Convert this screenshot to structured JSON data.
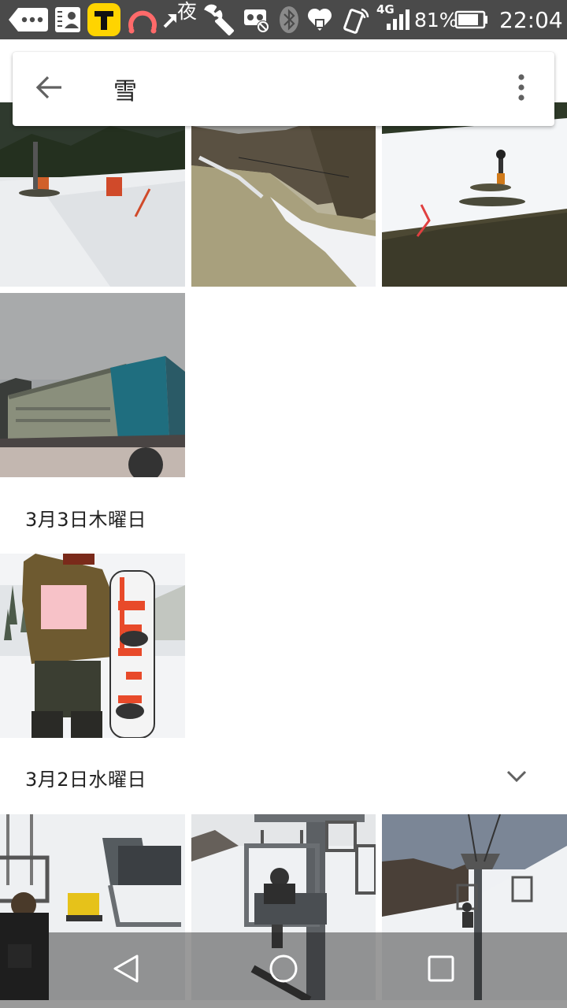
{
  "status_bar": {
    "night_label": "夜",
    "network_label": "4G",
    "battery_percent": "81%",
    "time": "22:04"
  },
  "search": {
    "query": "雪"
  },
  "sections": [
    {
      "date": "3月3日木曜日"
    },
    {
      "date": "3月2日水曜日"
    }
  ],
  "icons": {
    "back": "arrow-back-icon",
    "more": "more-vert-icon",
    "collapse": "chevron-down-icon",
    "nav_back": "nav-back-icon",
    "nav_home": "nav-home-icon",
    "nav_recents": "nav-recents-icon"
  },
  "colors": {
    "status_bar": "#4a4a4a",
    "accent_yellow": "#ffd400",
    "text_primary": "#212121",
    "icon_gray": "#616161"
  }
}
